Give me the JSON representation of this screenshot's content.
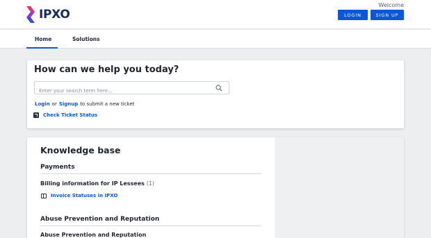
{
  "header": {
    "brand": "IPXO",
    "welcome": "Welcome",
    "login_label": "LOGIN",
    "signup_label": "SIGN UP"
  },
  "nav": {
    "home": "Home",
    "solutions": "Solutions"
  },
  "help": {
    "title": "How can we help you today?",
    "search_placeholder": "Enter your search term here...",
    "login_link": "Login",
    "or": "or",
    "signup_link": "Signup",
    "submit_text": "to submit a new ticket",
    "check_ticket": "Check Ticket Status"
  },
  "knowledge_base": {
    "title": "Knowledge base",
    "sections": [
      {
        "title": "Payments",
        "folder": "Billing information for IP Lessees",
        "count": "(1)",
        "articles": [
          "Invoice Statuses in IPXO"
        ]
      },
      {
        "title": "Abuse Prevention and Reputation",
        "folder": "Abuse Prevention and Reputation"
      }
    ]
  },
  "colors": {
    "accent": "#0b57d6",
    "brand_navy": "#1b2a5e",
    "logo_pink": "#e8336d",
    "logo_purple": "#6a3ad6"
  }
}
